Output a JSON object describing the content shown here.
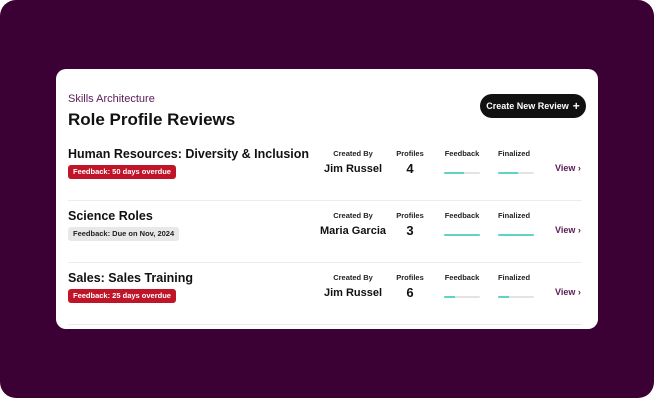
{
  "header": {
    "eyebrow": "Skills Architecture",
    "title": "Role Profile Reviews",
    "create_label": "Create New Review"
  },
  "columns": {
    "created_by": "Created By",
    "profiles": "Profiles",
    "feedback": "Feedback",
    "finalized": "Finalized"
  },
  "reviews": [
    {
      "title": "Human Resources: Diversity & Inclusion",
      "badge": "Feedback: 50 days overdue",
      "badge_status": "overdue",
      "created_by": "Jim Russel",
      "profiles": "4",
      "feedback_progress": 0.55,
      "finalized_progress": 0.55,
      "view_label": "View"
    },
    {
      "title": "Science Roles",
      "badge": "Feedback: Due on Nov, 2024",
      "badge_status": "due",
      "created_by": "Maria Garcia",
      "profiles": "3",
      "feedback_progress": 1.0,
      "finalized_progress": 1.0,
      "view_label": "View"
    },
    {
      "title": "Sales: Sales Training",
      "badge": "Feedback: 25 days overdue",
      "badge_status": "overdue",
      "created_by": "Jim Russel",
      "profiles": "6",
      "feedback_progress": 0.3,
      "finalized_progress": 0.3,
      "view_label": "View"
    }
  ],
  "colors": {
    "background": "#3b0034",
    "accent_text": "#5a1a55",
    "overdue": "#c01428",
    "progress": "#5fd4c2"
  },
  "icons": {
    "create": "plus-icon",
    "view": "chevron-right-icon"
  }
}
